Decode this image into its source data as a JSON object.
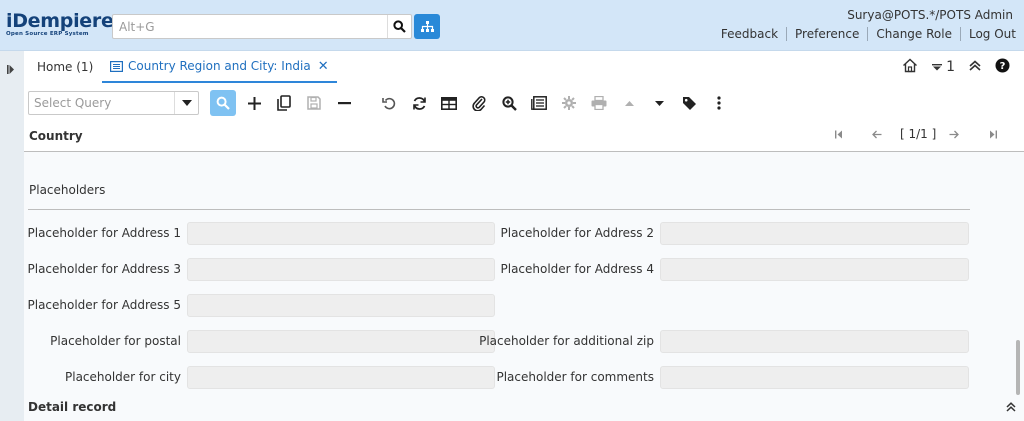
{
  "app": {
    "logo_text": "iDempiere",
    "logo_sub": "Open Source ERP System",
    "search_placeholder": "Alt+G",
    "user": "Surya@POTS.*/POTS Admin",
    "links": [
      "Feedback",
      "Preference",
      "Change Role",
      "Log Out"
    ]
  },
  "tabs": {
    "home": "Home (1)",
    "active": "Country Region and City: India",
    "counter": "1"
  },
  "toolbar": {
    "query_placeholder": "Select Query"
  },
  "section": {
    "title": "Country",
    "record_nav": "[ 1/1 ]"
  },
  "form": {
    "group_title": "Placeholders",
    "fields": [
      {
        "label": "Placeholder for Address 1",
        "value": ""
      },
      {
        "label": "Placeholder for Address 2",
        "value": ""
      },
      {
        "label": "Placeholder for Address 3",
        "value": ""
      },
      {
        "label": "Placeholder for Address 4",
        "value": ""
      },
      {
        "label": "Placeholder for Address 5",
        "value": ""
      },
      {
        "label": "Placeholder for postal",
        "value": ""
      },
      {
        "label": "Placeholder for additional zip",
        "value": ""
      },
      {
        "label": "Placeholder for city",
        "value": ""
      },
      {
        "label": "Placeholder for comments",
        "value": ""
      }
    ]
  },
  "detail": {
    "title": "Detail record"
  },
  "colors": {
    "header_bg": "#d3e6f8",
    "accent": "#2989d8",
    "active_tab": "#1f6fbf",
    "field_bg": "#eeeeee"
  }
}
